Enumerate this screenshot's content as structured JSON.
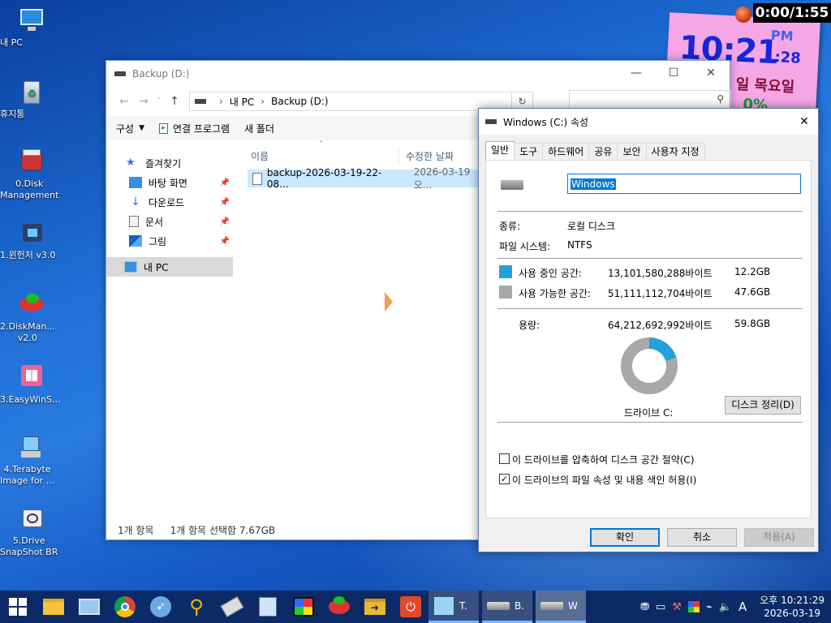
{
  "desktop": {
    "icons": [
      {
        "label": "내 PC",
        "icon": "monitor-icon"
      },
      {
        "label": "휴지통",
        "icon": "recycle-bin-icon"
      },
      {
        "label": "0.Disk\nManagement",
        "icon": "toolbox-icon"
      },
      {
        "label": "1.윈헌처 v3.0",
        "icon": "usb-drive-icon"
      },
      {
        "label": "2.DiskMan...\nv2.0",
        "icon": "disk-manager-icon"
      },
      {
        "label": "3.EasyWinS...",
        "icon": "windows-logo-icon"
      },
      {
        "label": "4.Terabyte\nImage for ...",
        "icon": "terabyte-icon"
      },
      {
        "label": "5.Drive\nSnapShot BR",
        "icon": "snapshot-icon"
      }
    ]
  },
  "sticky_clock": {
    "time": "10:21",
    "ampm": "PM",
    "seconds": ":28",
    "day": "일 목요일",
    "percent": "0%"
  },
  "timer": "0:00/1:55",
  "explorer": {
    "title": "Backup (D:)",
    "breadcrumb": [
      "내 PC",
      "Backup (D:)"
    ],
    "commands": {
      "organize": "구성",
      "open_with": "연결 프로그램",
      "new_folder": "새 폴더"
    },
    "nav": {
      "quick_access": "즐겨찾기",
      "items": [
        "바탕 화면",
        "다운로드",
        "문서",
        "그림"
      ],
      "this_pc": "내 PC"
    },
    "columns": {
      "name": "이름",
      "date": "수정한 날짜"
    },
    "file": {
      "name": "backup-2026-03-19-22-08...",
      "date": "2026-03-19 오..."
    },
    "status": {
      "count": "1개 항목",
      "selected": "1개 항목 선택함 7.67GB"
    }
  },
  "properties": {
    "title": "Windows (C:) 속성",
    "tabs": [
      "일반",
      "도구",
      "하드웨어",
      "공유",
      "보안",
      "사용자 지정"
    ],
    "volume_name": "Windows",
    "type_label": "종류:",
    "type_value": "로컬 디스크",
    "fs_label": "파일 시스템:",
    "fs_value": "NTFS",
    "used_label": "사용 중인 공간:",
    "used_bytes": "13,101,580,288바이트",
    "used_gb": "12.2GB",
    "free_label": "사용 가능한 공간:",
    "free_bytes": "51,111,112,704바이트",
    "free_gb": "47.6GB",
    "capacity_label": "용량:",
    "capacity_bytes": "64,212,692,992바이트",
    "capacity_gb": "59.8GB",
    "used_fraction": 0.204,
    "drive_label": "드라이브 C:",
    "cleanup_button": "디스크 정리(D)",
    "compress_check": "이 드라이브를 압축하여 디스크 공간 절약(C)",
    "index_check": "이 드라이브의 파일 속성 및 내용 색인 허용(I)",
    "ok": "확인",
    "cancel": "취소",
    "apply": "적용(A)",
    "colors": {
      "used": "#26a0da",
      "free": "#a8a8a8"
    }
  },
  "taskbar": {
    "tasks": [
      {
        "label": "T.",
        "icon": "terabyte-task-icon"
      },
      {
        "label": "B.",
        "icon": "drive-task-icon"
      },
      {
        "label": "W",
        "icon": "drive-task-icon"
      }
    ],
    "clock_time": "오후 10:21:29",
    "clock_date": "2026-03-19",
    "ime": "A"
  }
}
